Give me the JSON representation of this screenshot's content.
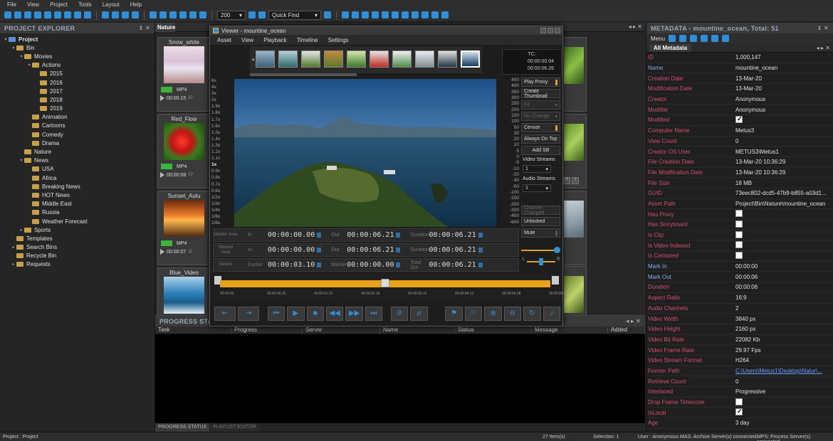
{
  "menu": [
    "File",
    "View",
    "Project",
    "Tools",
    "Layout",
    "Help"
  ],
  "toolbar": {
    "zoom_value": "200",
    "quick_find_placeholder": "Quick Find"
  },
  "explorer": {
    "title": "PROJECT EXPLORER",
    "tree": [
      {
        "label": "Project",
        "depth": 0,
        "arrow": "▾",
        "bold": true
      },
      {
        "label": "Bin",
        "depth": 1,
        "arrow": "▾"
      },
      {
        "label": "Movies",
        "depth": 2,
        "arrow": "▾"
      },
      {
        "label": "Actions",
        "depth": 3,
        "arrow": "▾"
      },
      {
        "label": "2015",
        "depth": 4,
        "arrow": ""
      },
      {
        "label": "2016",
        "depth": 4,
        "arrow": ""
      },
      {
        "label": "2017",
        "depth": 4,
        "arrow": ""
      },
      {
        "label": "2018",
        "depth": 4,
        "arrow": ""
      },
      {
        "label": "2019",
        "depth": 4,
        "arrow": ""
      },
      {
        "label": "Animation",
        "depth": 3,
        "arrow": ""
      },
      {
        "label": "Cartoons",
        "depth": 3,
        "arrow": ""
      },
      {
        "label": "Comedy",
        "depth": 3,
        "arrow": ""
      },
      {
        "label": "Drama",
        "depth": 3,
        "arrow": ""
      },
      {
        "label": "Nature",
        "depth": 2,
        "arrow": ""
      },
      {
        "label": "News",
        "depth": 2,
        "arrow": "▾"
      },
      {
        "label": "USA",
        "depth": 3,
        "arrow": ""
      },
      {
        "label": "Africa",
        "depth": 3,
        "arrow": ""
      },
      {
        "label": "Breaking News",
        "depth": 3,
        "arrow": ""
      },
      {
        "label": "HOT News",
        "depth": 3,
        "arrow": ""
      },
      {
        "label": "Middle East",
        "depth": 3,
        "arrow": ""
      },
      {
        "label": "Russia",
        "depth": 3,
        "arrow": ""
      },
      {
        "label": "Weather Forecast",
        "depth": 3,
        "arrow": ""
      },
      {
        "label": "Sports",
        "depth": 2,
        "arrow": "▸"
      },
      {
        "label": "Templates",
        "depth": 1,
        "arrow": ""
      },
      {
        "label": "Search Bins",
        "depth": 1,
        "arrow": "▸"
      },
      {
        "label": "Recycle Bin",
        "depth": 1,
        "arrow": ""
      },
      {
        "label": "Requests",
        "depth": 1,
        "arrow": "▸"
      }
    ]
  },
  "nature": {
    "tab": "Nature",
    "cards": [
      {
        "title": "Snow_white",
        "format": "MP4",
        "duration": "00:00:15",
        "frames": "07"
      },
      {
        "title": "Red_Flow",
        "format": "MP4",
        "duration": "00:00:08",
        "frames": "07"
      },
      {
        "title": "Sunset_Autu",
        "format": "MP4",
        "duration": "00:00:07",
        "frames": "11"
      },
      {
        "title": "Blue_Video",
        "format": "",
        "duration": "",
        "frames": ""
      }
    ]
  },
  "viewer": {
    "title": "Viewer - mountine_ocean",
    "menu": [
      "Asset",
      "View",
      "Playback",
      "Timeline",
      "Settings"
    ],
    "tc_label": "TC:",
    "tc_line1": "00:00:00.04",
    "tc_line2": "00:00:06.26",
    "speeds": [
      "6x",
      "4x",
      "3x",
      "2x",
      "1.9x",
      "1.8x",
      "1.7x",
      "1.6x",
      "1.5x",
      "1.4x",
      "1.3x",
      "1.2x",
      "1.1x",
      "1x",
      "0.9x",
      "0.8x",
      "0.7x",
      "0.6x",
      "1/2x",
      "1/3x",
      "1/4x",
      "1/6x",
      "1/8x"
    ],
    "meters": [
      "450",
      "400",
      "350",
      "300",
      "250",
      "200",
      "150",
      "100",
      "50",
      "30",
      "20",
      "10",
      "5",
      "0",
      "-5",
      "-10",
      "-20",
      "-30",
      "-50",
      "-100",
      "-150",
      "-200",
      "-300",
      "-450",
      "-600"
    ],
    "buttons": {
      "play_proxy": "Play Proxy",
      "create_thumbnail": "Create Thumbnail",
      "fit": "Fit",
      "no_change": "No Change",
      "censor": "Censor",
      "always_on_top": "Always On Top",
      "add_sb": "Add SB",
      "video_streams": "Video Streams",
      "video_streams_value": "1",
      "audio_streams": "Audio Streams",
      "audio_streams_value": "1",
      "channel_changed": "Channel Changed",
      "unlocked": "Unlocked",
      "mute": "Mute",
      "l": "L",
      "r": "R"
    },
    "rows": [
      {
        "label": "Master Area",
        "in_label": "In",
        "in": "00:00:00.00",
        "out_label": "Out",
        "out": "00:00:06.21",
        "third_label": "Duration",
        "third": "00:00:06.21"
      },
      {
        "label": "Marked Area",
        "in_label": "In",
        "in": "00:00:00.00",
        "out_label": "Out",
        "out": "00:00:06.21",
        "third_label": "Duration",
        "third": "00:00:06.21"
      },
      {
        "label": "Details",
        "in_label": "Cursor",
        "in": "00:00:03.10",
        "out_label": "Marker",
        "out": "00:00:00.00",
        "third_label": "Total Dur",
        "third": "00:00:06.21"
      }
    ],
    "timeline_position": 0.5,
    "timeline_ticks": [
      "00:00:00",
      "00:00:00.26",
      "00:00:01.23",
      "00:00:02.19",
      "00:00:03.15",
      "00:00:04.12",
      "00:00:05.08",
      "00:00:06.04"
    ]
  },
  "progress": {
    "title": "PROGRESS STATUS",
    "columns": [
      "Task",
      "Progress",
      "Server",
      "Name",
      "Status",
      "Message",
      "Added"
    ],
    "tabs": [
      "PROGRESS STATUS",
      "PLAYLIST EDITOR"
    ]
  },
  "metadata": {
    "title": "METADATA - mountine_ocean, Total: 51",
    "toolbar_menu": "Menu",
    "tab": "All Metadata",
    "rows": [
      {
        "key": "ID",
        "value": "1,000,147",
        "type": "text",
        "blue": false
      },
      {
        "key": "Name",
        "value": "mountine_ocean",
        "type": "text",
        "blue": true
      },
      {
        "key": "Creation Date",
        "value": "13-Mar-20",
        "type": "text",
        "blue": false
      },
      {
        "key": "Modification Date",
        "value": "13-Mar-20",
        "type": "text",
        "blue": false
      },
      {
        "key": "Creator",
        "value": "Anonymous",
        "type": "text",
        "blue": false
      },
      {
        "key": "Modifier",
        "value": "Anonymous",
        "type": "text",
        "blue": false
      },
      {
        "key": "Modified",
        "value": "",
        "type": "checked",
        "blue": false
      },
      {
        "key": "Computer Name",
        "value": "Metus3",
        "type": "text",
        "blue": false
      },
      {
        "key": "View Count",
        "value": "0",
        "type": "text",
        "blue": false
      },
      {
        "key": "Creator OS User",
        "value": "METUS3\\Metus1",
        "type": "text",
        "blue": false
      },
      {
        "key": "File Creation Date",
        "value": "13-Mar-20 10:36:29",
        "type": "text",
        "blue": false
      },
      {
        "key": "File Modification Date",
        "value": "13-Mar-20 10:36:29",
        "type": "text",
        "blue": false
      },
      {
        "key": "File Size",
        "value": "18 MB",
        "type": "text",
        "blue": false
      },
      {
        "key": "GUID",
        "value": "73eec802-dcd5-47b9-b855-a03d1...",
        "type": "text",
        "blue": false
      },
      {
        "key": "Asset Path",
        "value": "Project\\Bin\\Nature\\mountine_ocean",
        "type": "text",
        "blue": false
      },
      {
        "key": "Has Proxy",
        "value": "",
        "type": "unchecked",
        "blue": false
      },
      {
        "key": "Has Storyboard",
        "value": "",
        "type": "unchecked",
        "blue": false
      },
      {
        "key": "Is Clip",
        "value": "",
        "type": "unchecked",
        "blue": false
      },
      {
        "key": "Is Video Indexed",
        "value": "",
        "type": "unchecked",
        "blue": false
      },
      {
        "key": "Is Censored",
        "value": "",
        "type": "unchecked",
        "blue": false
      },
      {
        "key": "Mark In",
        "value": "00:00:00",
        "type": "text",
        "blue": true
      },
      {
        "key": "Mark Out",
        "value": "00:00:06",
        "type": "text",
        "blue": true
      },
      {
        "key": "Duration",
        "value": "00:00:06",
        "type": "text",
        "blue": false
      },
      {
        "key": "Aspect Ratio",
        "value": "16:9",
        "type": "text",
        "blue": false
      },
      {
        "key": "Audio Channels",
        "value": "2",
        "type": "text",
        "blue": false
      },
      {
        "key": "Video Width",
        "value": "3840 px",
        "type": "text",
        "blue": false
      },
      {
        "key": "Video Height",
        "value": "2160 px",
        "type": "text",
        "blue": false
      },
      {
        "key": "Video Bit Rate",
        "value": "22082 Kb",
        "type": "text",
        "blue": false
      },
      {
        "key": "Video Frame Rate",
        "value": "29.97 Fps",
        "type": "text",
        "blue": false
      },
      {
        "key": "Video Stream Format",
        "value": "H264",
        "type": "text",
        "blue": false
      },
      {
        "key": "Former Path",
        "value": "C:\\Users\\Metus1\\Desktop\\Natur\\...",
        "type": "link",
        "blue": false
      },
      {
        "key": "Retrieve Count",
        "value": "0",
        "type": "text",
        "blue": false
      },
      {
        "key": "Interlaced",
        "value": "Progressive",
        "type": "text",
        "blue": false
      },
      {
        "key": "Drop Frame Timecode",
        "value": "",
        "type": "unchecked",
        "blue": false
      },
      {
        "key": "IsLocal",
        "value": "",
        "type": "checked",
        "blue": false
      },
      {
        "key": "Age",
        "value": "3 day",
        "type": "text",
        "blue": false
      }
    ]
  },
  "statusbar": {
    "left": "Project : Project",
    "items": "27 Item(s)",
    "selection": "Selection: 1",
    "user": "User : Anonymous",
    "mas": "MAS: Archive Server(s) connected.",
    "mps": "MPS: Process Server(s) connected."
  }
}
